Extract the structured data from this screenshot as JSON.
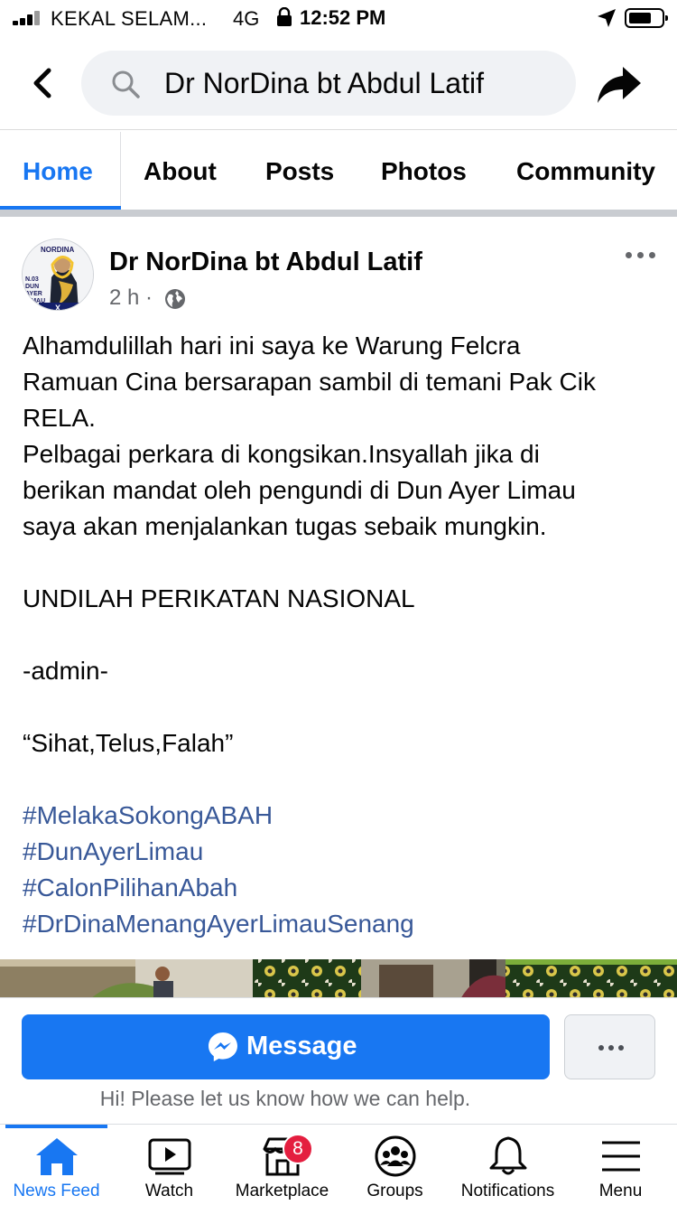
{
  "status_bar": {
    "carrier": "KEKAL SELAM...",
    "network": "4G",
    "time": "12:52 PM"
  },
  "topnav": {
    "search_text": "Dr NorDina bt Abdul Latif"
  },
  "tabs": [
    {
      "label": "Home",
      "active": true
    },
    {
      "label": "About"
    },
    {
      "label": "Posts"
    },
    {
      "label": "Photos"
    },
    {
      "label": "Community"
    }
  ],
  "post": {
    "author": "Dr NorDina bt Abdul Latif",
    "time": "2 h",
    "meta_separator": "·",
    "avatar_text": {
      "name": "NORDINA",
      "line2": "N.03",
      "line3": "DUN",
      "line4": "AYER",
      "line5": "LIMAU",
      "mark": "X"
    },
    "lines": [
      "Alhamdulillah hari ini saya ke Warung Felcra",
      "Ramuan Cina bersarapan sambil di temani Pak Cik",
      "RELA.",
      "Pelbagai perkara di kongsikan.Insyallah jika di",
      "berikan mandat oleh pengundi di Dun Ayer Limau",
      "saya akan menjalankan tugas sebaik mungkin."
    ],
    "slogan": "UNDILAH PERIKATAN NASIONAL",
    "signoff": "-admin-",
    "motto": "“Sihat,Telus,Falah”",
    "hashtags": [
      "#MelakaSokongABAH",
      "#DunAyerLimau",
      "#CalonPilihanAbah",
      "#DrDinaMenangAyerLimauSenang"
    ]
  },
  "message_bar": {
    "button_label": "Message",
    "hint": "Hi! Please let us know how we can help."
  },
  "bottom_nav": [
    {
      "label": "News Feed",
      "icon": "home-icon",
      "active": true
    },
    {
      "label": "Watch",
      "icon": "watch-icon"
    },
    {
      "label": "Marketplace",
      "icon": "marketplace-icon",
      "badge": "8"
    },
    {
      "label": "Groups",
      "icon": "groups-icon"
    },
    {
      "label": "Notifications",
      "icon": "bell-icon"
    },
    {
      "label": "Menu",
      "icon": "menu-icon"
    }
  ],
  "colors": {
    "accent": "#1877f2",
    "hashtag": "#385898",
    "secondary_text": "#65676b",
    "badge": "#e41e3f"
  }
}
